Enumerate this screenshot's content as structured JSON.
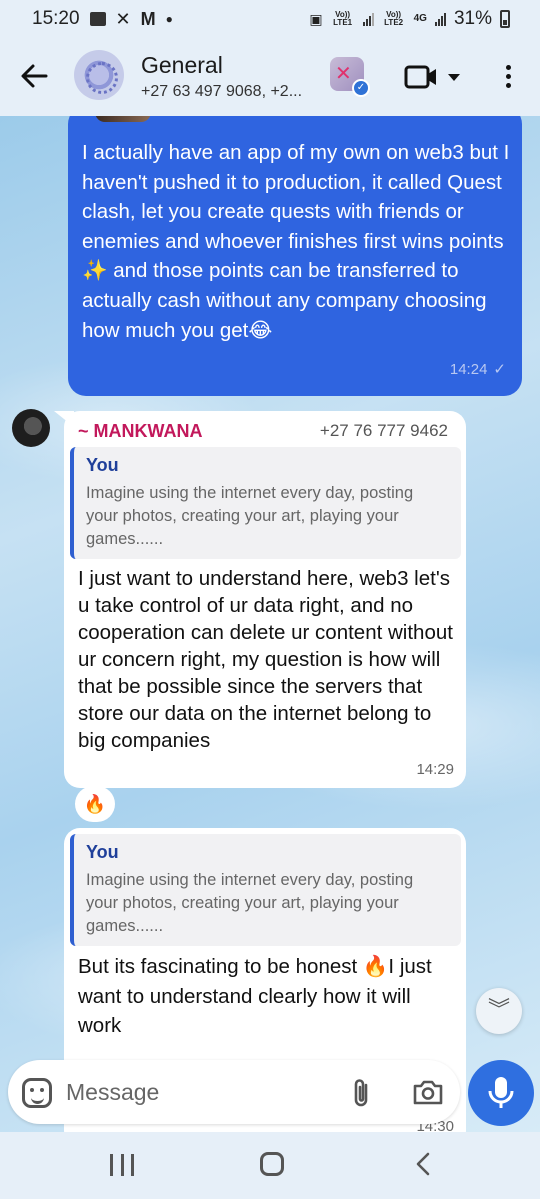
{
  "status_bar": {
    "time": "15:20",
    "network_1": "Vo)) LTE1",
    "network_2": "Vo)) LTE2",
    "network_type": "4G",
    "battery": "31%"
  },
  "header": {
    "title": "General",
    "subtitle": "+27 63 497 9068, +2..."
  },
  "messages": {
    "outgoing_1": {
      "text": "I actually have an app of my own on web3 but I haven't pushed it to production, it called Quest clash, let you create quests with friends or enemies and whoever finishes first wins points ✨ and those points can be transferred to actually cash without any company choosing how much you get😂",
      "time": "14:24"
    },
    "incoming_1": {
      "sender_name": "~ MANKWANA",
      "sender_phone": "+27 76 777 9462",
      "reply_name": "You",
      "reply_text": "Imagine using the internet every day, posting your photos, creating your art, playing your games......",
      "text": "I just want to understand here, web3 let's u take control of ur data right, and no cooperation can delete ur content without ur concern right, my question is how will that be possible since the servers that store our data on the internet belong to big companies",
      "time": "14:29",
      "reaction": "🔥"
    },
    "incoming_2": {
      "reply_name": "You",
      "reply_text": "Imagine using the internet every day, posting your photos, creating your art, playing your games......",
      "text": "But its fascinating to be honest 🔥I just want to understand clearly how it will work",
      "time": "14:30"
    }
  },
  "input": {
    "placeholder": "Message"
  },
  "colors": {
    "outgoing_bubble": "#2f64e0",
    "sender_name": "#c2185b",
    "mic_button": "#2f6fe0"
  }
}
